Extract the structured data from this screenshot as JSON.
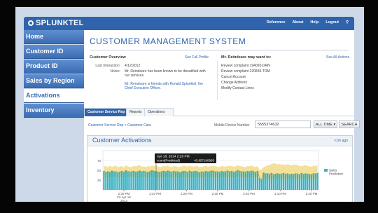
{
  "app": {
    "brand": "SPLUNKTEL"
  },
  "topnav": [
    "Reference",
    "About",
    "Help",
    "Logout"
  ],
  "sidebar": [
    {
      "label": "Home",
      "active": false
    },
    {
      "label": "Customer ID",
      "active": false
    },
    {
      "label": "Product ID",
      "active": false
    },
    {
      "label": "Sales by Region",
      "active": false
    },
    {
      "label": "Activations",
      "active": true
    },
    {
      "label": "Inventory",
      "active": false
    }
  ],
  "page": {
    "title": "CUSTOMER MANAGEMENT SYSTEM"
  },
  "overview": {
    "heading": "Customer Overview",
    "link": "See Full Profile",
    "last_interaction_label": "Last Interaction:",
    "last_interaction_value": "4/12/2012",
    "notes_label": "Notes:",
    "note1": "Mr. Reindeare has been known to be dissatified with our services.",
    "note2": "Mr. Reindeare is friends with Ronald Splunktel, the Chief Executive Officer."
  },
  "actions": {
    "heading": "Mr. Reindeare may want to:",
    "link": "See All Actions",
    "items": [
      "Review complaint 194092-DRN",
      "Review complaint 220835-TRM",
      "Cancel Account",
      "Change Address",
      "Modify Contact Lines"
    ]
  },
  "tabs": [
    "Customer Service Rep",
    "Reports",
    "Operations"
  ],
  "breadcrumb": "Customer Service Rep > Customer Care",
  "device": {
    "label": "Mobile Device Number",
    "value": "5555374632"
  },
  "time_button": "ALL TIME ▾",
  "search_button": "SEARCH",
  "card": {
    "title": "Customer Activations",
    "link": "<1m ago"
  },
  "tooltip": {
    "line1": "Apr 18, 2014 2:28 PM",
    "line2": "count(Predicted)",
    "line3": "43.657160865"
  },
  "legend_label": "Sales Prediction",
  "colors": {
    "brand": "#2f64ad",
    "bars": "#37b3c4",
    "band": "#f1dc8a"
  },
  "chart_data": {
    "type": "bar",
    "ylim": [
      0,
      100
    ],
    "yticks": [
      "75",
      "50",
      "25"
    ],
    "xticks": [
      {
        "label": "2:30 PM",
        "sub": "Fri Apr 18",
        "sub2": "2014"
      },
      {
        "label": "2:20 PM"
      },
      {
        "label": "2:20 PM"
      },
      {
        "label": "2:30 PM"
      },
      {
        "label": "2:40 PM"
      },
      {
        "label": "2:10 PM"
      },
      {
        "label": "2:20 PM"
      }
    ],
    "series": [
      {
        "name": "Sales Prediction",
        "values": [
          48,
          45,
          47,
          45,
          49,
          46,
          47,
          44,
          46,
          48,
          45,
          50,
          47,
          46,
          47,
          48,
          45,
          47,
          49,
          46,
          48,
          46,
          45,
          47,
          50,
          48,
          47,
          46,
          45,
          47,
          48,
          46,
          49,
          47,
          45,
          48,
          46,
          47,
          44,
          46,
          48,
          47,
          45,
          49,
          46,
          47,
          48,
          46,
          44,
          47,
          45,
          48,
          46,
          47,
          49,
          48,
          46,
          47,
          45,
          48,
          46,
          47,
          49,
          46,
          48,
          45,
          47,
          50,
          48,
          46,
          47,
          45,
          48,
          46,
          49,
          47,
          45,
          48,
          30,
          27,
          44,
          41,
          42,
          40,
          43,
          39,
          41,
          42,
          40,
          41,
          43,
          40,
          42,
          39,
          41,
          40,
          42,
          41,
          39,
          43,
          40,
          42,
          41,
          40,
          39,
          42,
          41,
          43
        ]
      }
    ],
    "band": {
      "upper": [
        62,
        60,
        58,
        61,
        59,
        60,
        62,
        58,
        59,
        61,
        57,
        63,
        60,
        58,
        59,
        61,
        60,
        62,
        63,
        59,
        60,
        58,
        61,
        59,
        62,
        61,
        63,
        60,
        58,
        59,
        61,
        60,
        62,
        59,
        58,
        61,
        60,
        59,
        58,
        60,
        62,
        61,
        59,
        62,
        60,
        59,
        61,
        60,
        58,
        59,
        60,
        61,
        59,
        60,
        62,
        61,
        60,
        59,
        58,
        61,
        60,
        59,
        62,
        60,
        61,
        59,
        60,
        63,
        61,
        60,
        59,
        58,
        61,
        60,
        62,
        60,
        58,
        61,
        50,
        52,
        58,
        60,
        62,
        64,
        66,
        68,
        67,
        65,
        66,
        64,
        65,
        63,
        66,
        64,
        62,
        65,
        64,
        63,
        61,
        60,
        62,
        63,
        61,
        60,
        59,
        62,
        61,
        63
      ],
      "lower": [
        33,
        31,
        32,
        30,
        34,
        32,
        33,
        30,
        31,
        34,
        30,
        35,
        32,
        31,
        33,
        34,
        31,
        32,
        34,
        31,
        33,
        32,
        30,
        32,
        35,
        33,
        32,
        31,
        30,
        32,
        33,
        31,
        34,
        32,
        30,
        33,
        31,
        32,
        30,
        31,
        33,
        32,
        30,
        34,
        31,
        32,
        33,
        31,
        30,
        32,
        30,
        33,
        31,
        32,
        34,
        33,
        31,
        32,
        30,
        33,
        31,
        32,
        34,
        31,
        33,
        30,
        32,
        35,
        33,
        31,
        32,
        30,
        33,
        31,
        34,
        32,
        30,
        33,
        20,
        18,
        30,
        29,
        28,
        27,
        29,
        26,
        28,
        29,
        27,
        28,
        30,
        27,
        29,
        26,
        28,
        27,
        29,
        28,
        26,
        30,
        27,
        29,
        28,
        27,
        26,
        29,
        28,
        30
      ]
    },
    "gap_index": [
      78,
      79
    ]
  }
}
